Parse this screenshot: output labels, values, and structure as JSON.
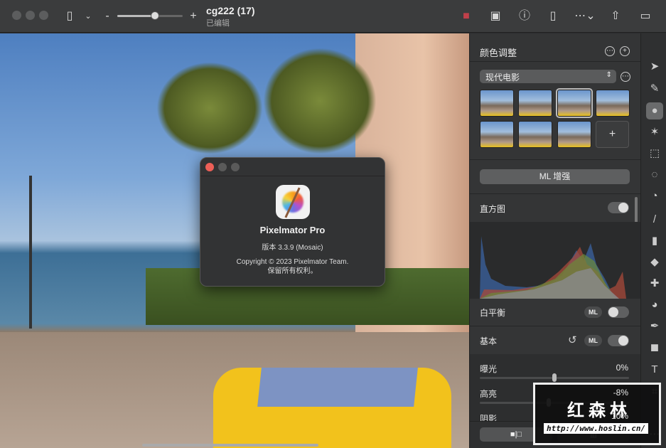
{
  "window": {
    "title": "cg222 (17)",
    "subtitle": "已编辑",
    "zoom_minus": "-",
    "zoom_plus": "+",
    "zoom_level": 0.6
  },
  "about": {
    "app_name": "Pixelmator Pro",
    "version": "版本 3.3.9 (Mosaic)",
    "copyright": "Copyright © 2023 Pixelmator Team.",
    "rights": "保留所有权利。"
  },
  "panel": {
    "title": "颜色调整",
    "preset": "现代电影",
    "add_preset": "+",
    "ml_enhance": "ML 增强",
    "histogram": {
      "label": "直方图",
      "on": true
    },
    "white_balance": {
      "label": "白平衡",
      "ml": "ML",
      "on": false
    },
    "basic": {
      "label": "基本",
      "ml": "ML",
      "on": true
    },
    "sliders": [
      {
        "label": "曝光",
        "value": "0%",
        "pos": 0.5
      },
      {
        "label": "高亮",
        "value": "-8%",
        "pos": 0.46
      },
      {
        "label": "阴影",
        "value": "10%"
      }
    ]
  },
  "watermark": {
    "text": "红森林",
    "url": "http://www.hoslin.cn/"
  },
  "colors": {
    "accent_active_tool": "#6a6b6c",
    "panel_bg": "#343536"
  }
}
